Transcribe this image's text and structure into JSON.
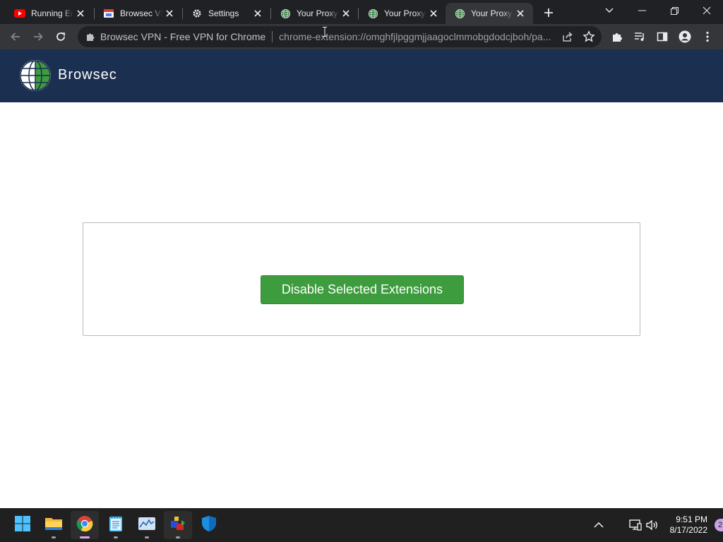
{
  "tabs": [
    {
      "title": "Running Errands Song",
      "icon": "youtube-icon"
    },
    {
      "title": "Browsec VPN",
      "icon": "browsec-store-icon"
    },
    {
      "title": "Settings",
      "icon": "gear-icon"
    },
    {
      "title": "Your Proxy",
      "icon": "globe-icon"
    },
    {
      "title": "Your Proxy",
      "icon": "globe-icon"
    },
    {
      "title": "Your Proxy",
      "icon": "globe-icon",
      "active": true
    }
  ],
  "omnibox": {
    "site_name": "Browsec VPN - Free VPN for Chrome",
    "url": "chrome-extension://omghfjlpggmjjaagoclmmobgdodcjboh/pa..."
  },
  "brand": {
    "name": "Browsec"
  },
  "main": {
    "disable_button_label": "Disable Selected Extensions"
  },
  "taskbar": {
    "apps": [
      "start-icon",
      "file-explorer-icon",
      "chrome-icon",
      "notepad-icon",
      "task-manager-icon",
      "app-icon",
      "windows-security-icon"
    ],
    "time": "9:51 PM",
    "date": "8/17/2022",
    "notification_count": "2"
  },
  "colors": {
    "brand_bar": "#1b2f50",
    "button_green": "#3d9c3d",
    "tab_strip": "#202124",
    "toolbar": "#35363a"
  }
}
